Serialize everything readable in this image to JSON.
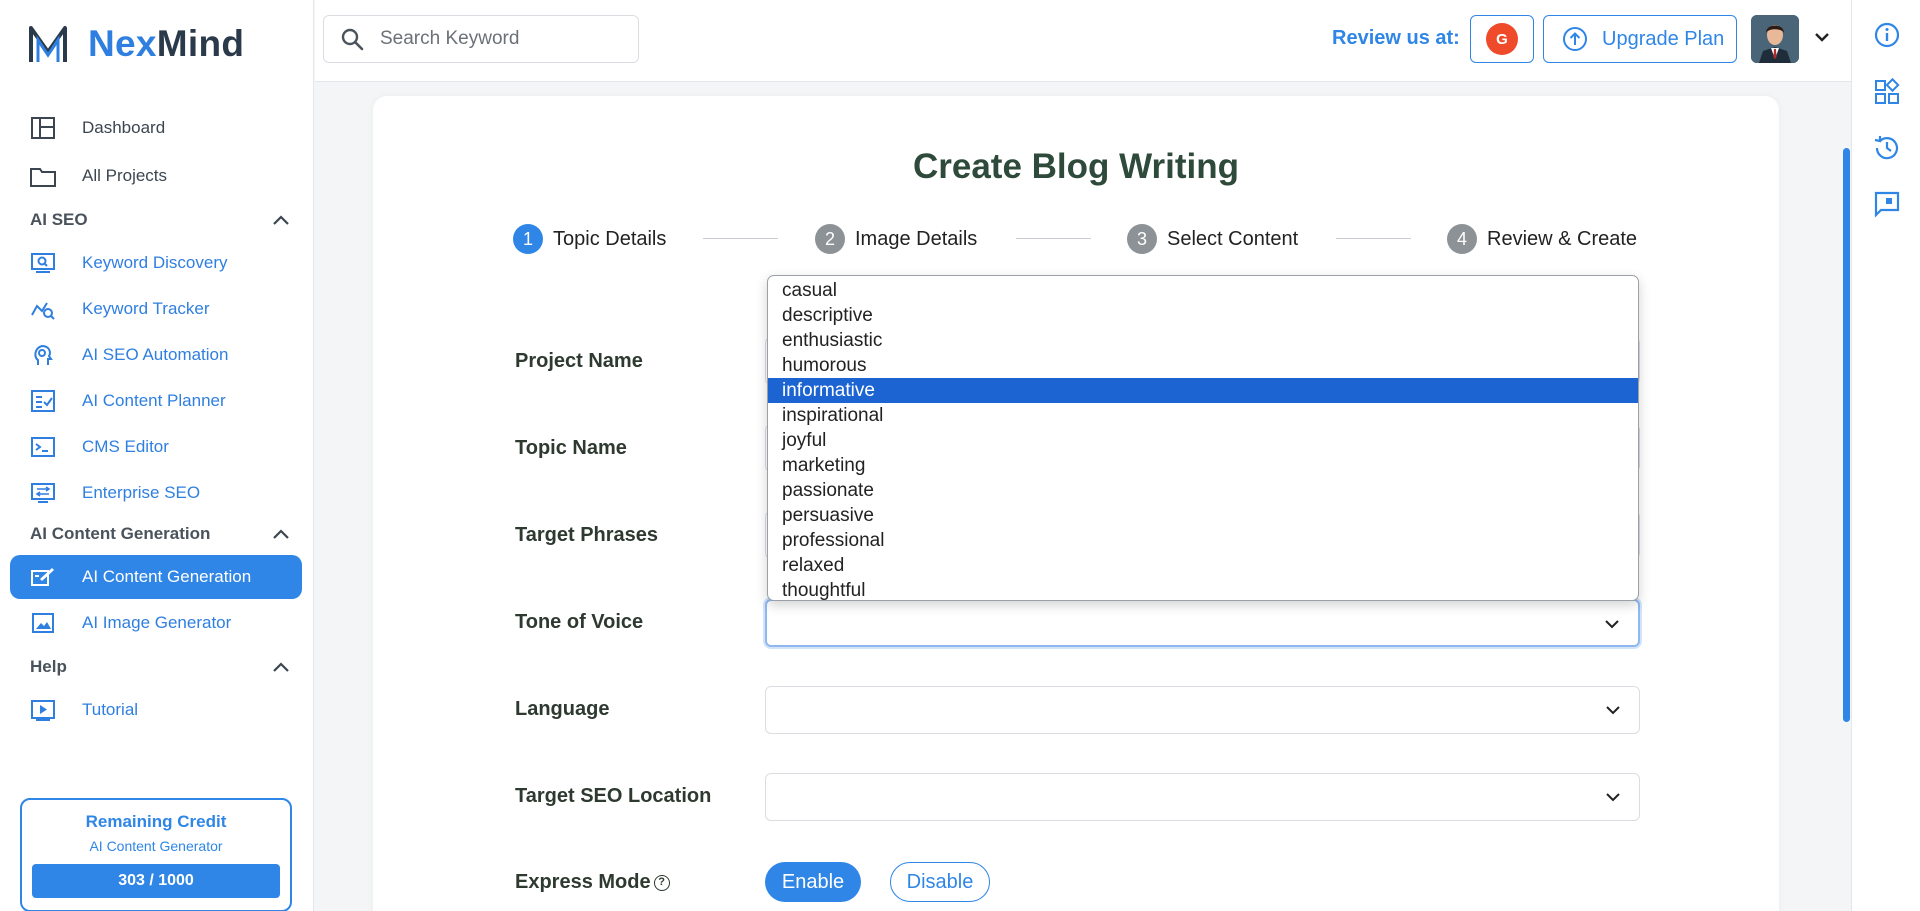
{
  "brand": {
    "name_part1": "Nex",
    "name_part2": "Mind"
  },
  "sidebar": {
    "top_items": [
      {
        "label": "Dashboard",
        "icon": "dashboard-icon"
      },
      {
        "label": "All Projects",
        "icon": "folder-icon"
      }
    ],
    "sections": [
      {
        "title": "AI SEO",
        "items": [
          {
            "label": "Keyword Discovery",
            "icon": "keyword-discovery-icon"
          },
          {
            "label": "Keyword Tracker",
            "icon": "keyword-tracker-icon"
          },
          {
            "label": "AI SEO Automation",
            "icon": "ai-seo-automation-icon"
          },
          {
            "label": "AI Content Planner",
            "icon": "content-planner-icon"
          },
          {
            "label": "CMS Editor",
            "icon": "cms-editor-icon"
          },
          {
            "label": "Enterprise SEO",
            "icon": "enterprise-seo-icon"
          }
        ]
      },
      {
        "title": "AI Content Generation",
        "items": [
          {
            "label": "AI Content Generation",
            "icon": "content-generation-icon",
            "active": true
          },
          {
            "label": "AI Image Generator",
            "icon": "image-generator-icon"
          }
        ]
      },
      {
        "title": "Help",
        "items": [
          {
            "label": "Tutorial",
            "icon": "tutorial-icon"
          }
        ]
      }
    ],
    "credit": {
      "title": "Remaining Credit",
      "subtitle": "AI Content Generator",
      "value": "303 / 1000",
      "used": 303,
      "total": 1000
    }
  },
  "header": {
    "search_placeholder": "Search Keyword",
    "review_label": "Review us at:",
    "g2_badge": "G",
    "upgrade_label": "Upgrade Plan"
  },
  "page": {
    "title": "Create Blog Writing",
    "steps": [
      {
        "num": "1",
        "label": "Topic Details",
        "active": true
      },
      {
        "num": "2",
        "label": "Image Details",
        "active": false
      },
      {
        "num": "3",
        "label": "Select Content",
        "active": false
      },
      {
        "num": "4",
        "label": "Review & Create",
        "active": false
      }
    ],
    "fields": {
      "project_name": "Project Name",
      "topic_name": "Topic Name",
      "target_phrases": "Target Phrases",
      "tone_of_voice": "Tone of Voice",
      "language": "Language",
      "target_seo_location": "Target SEO Location",
      "express_mode": "Express Mode"
    },
    "express_help": "?",
    "enable_label": "Enable",
    "disable_label": "Disable"
  },
  "tone_dropdown": {
    "options": [
      "casual",
      "descriptive",
      "enthusiastic",
      "humorous",
      "informative",
      "inspirational",
      "joyful",
      "marketing",
      "passionate",
      "persuasive",
      "professional",
      "relaxed",
      "thoughtful"
    ],
    "highlighted": "informative"
  },
  "colors": {
    "accent": "#2f86e6",
    "selection": "#1b64d2",
    "title": "#2e4a3a",
    "g2": "#ef4a2a"
  }
}
